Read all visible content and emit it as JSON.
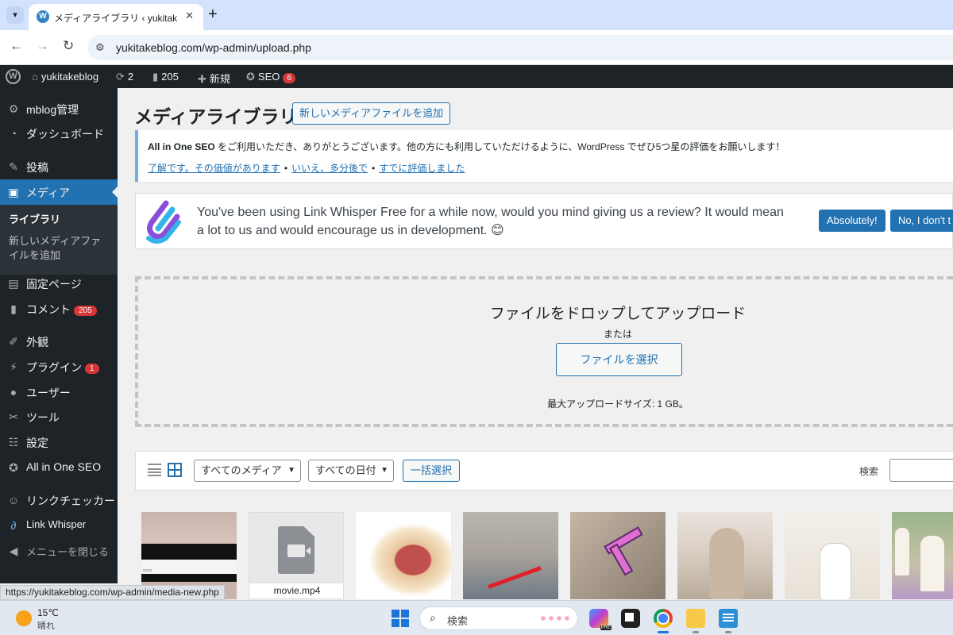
{
  "browser": {
    "tab_title": "メディアライブラリ ‹ yukitakeblog —",
    "tab_favicon": "wordpress-icon",
    "url": "yukitakeblog.com/wp-admin/upload.php",
    "status_url": "https://yukitakeblog.com/wp-admin/media-new.php"
  },
  "adminbar": {
    "site_name": "yukitakeblog",
    "updates_count": "2",
    "comments_count": "205",
    "new_label": "新規",
    "seo_label": "SEO",
    "seo_badge": "6"
  },
  "sidebar": {
    "items": [
      {
        "label": "mblog管理",
        "icon": "gear-icon"
      },
      {
        "label": "ダッシュボード",
        "icon": "dashboard-icon"
      },
      {
        "label": "投稿",
        "icon": "pin-icon"
      },
      {
        "label": "メディア",
        "icon": "media-icon"
      },
      {
        "label": "固定ページ",
        "icon": "page-icon"
      },
      {
        "label": "コメント",
        "icon": "comment-icon",
        "badge": "205"
      },
      {
        "label": "外観",
        "icon": "brush-icon"
      },
      {
        "label": "プラグイン",
        "icon": "plugin-icon",
        "badge": "1"
      },
      {
        "label": "ユーザー",
        "icon": "user-icon"
      },
      {
        "label": "ツール",
        "icon": "wrench-icon"
      },
      {
        "label": "設定",
        "icon": "settings-icon"
      },
      {
        "label": "All in One SEO",
        "icon": "aioseo-icon"
      },
      {
        "label": "リンクチェッカー",
        "icon": "link-checker-icon"
      },
      {
        "label": "Link Whisper",
        "icon": "link-whisper-icon"
      },
      {
        "label": "メニューを閉じる",
        "icon": "collapse-icon"
      }
    ],
    "submenu": {
      "library": "ライブラリ",
      "add_new": "新しいメディアファイルを追加"
    }
  },
  "main": {
    "title": "メディアライブラリ",
    "add_new_button": "新しいメディアファイルを追加",
    "aioseo_notice": {
      "brand": "All in One SEO",
      "message": " をご利用いただき、ありがとうございます。他の方にも利用していただけるように、WordPress でぜひ5つ星の評価をお願いします！",
      "link1": "了解です。その価値があります",
      "link2": "いいえ、多分後で",
      "link3": "すでに評価しました",
      "separator": "•"
    },
    "link_whisper_notice": {
      "message": "You've been using Link Whisper Free for a while now, would you mind giving us a review? It would mean a lot to us and would encourage us in development. 😊",
      "yes_button": "Absolutely!",
      "no_button": "No, I don't t"
    },
    "upload": {
      "title": "ファイルをドロップしてアップロード",
      "or": "または",
      "select_button": "ファイルを選択",
      "max_size": "最大アップロードサイズ: 1 GB。"
    },
    "toolbar": {
      "media_filter": "すべてのメディア",
      "date_filter": "すべての日付",
      "bulk_select": "一括選択",
      "search_label": "検索",
      "search_value": ""
    },
    "thumbnails": [
      {
        "kind": "image"
      },
      {
        "kind": "video",
        "filename": "movie.mp4"
      },
      {
        "kind": "image"
      },
      {
        "kind": "image"
      },
      {
        "kind": "image"
      },
      {
        "kind": "image"
      },
      {
        "kind": "image"
      },
      {
        "kind": "image"
      }
    ]
  },
  "taskbar": {
    "temperature": "15℃",
    "condition": "晴れ",
    "search_placeholder": "検索"
  }
}
